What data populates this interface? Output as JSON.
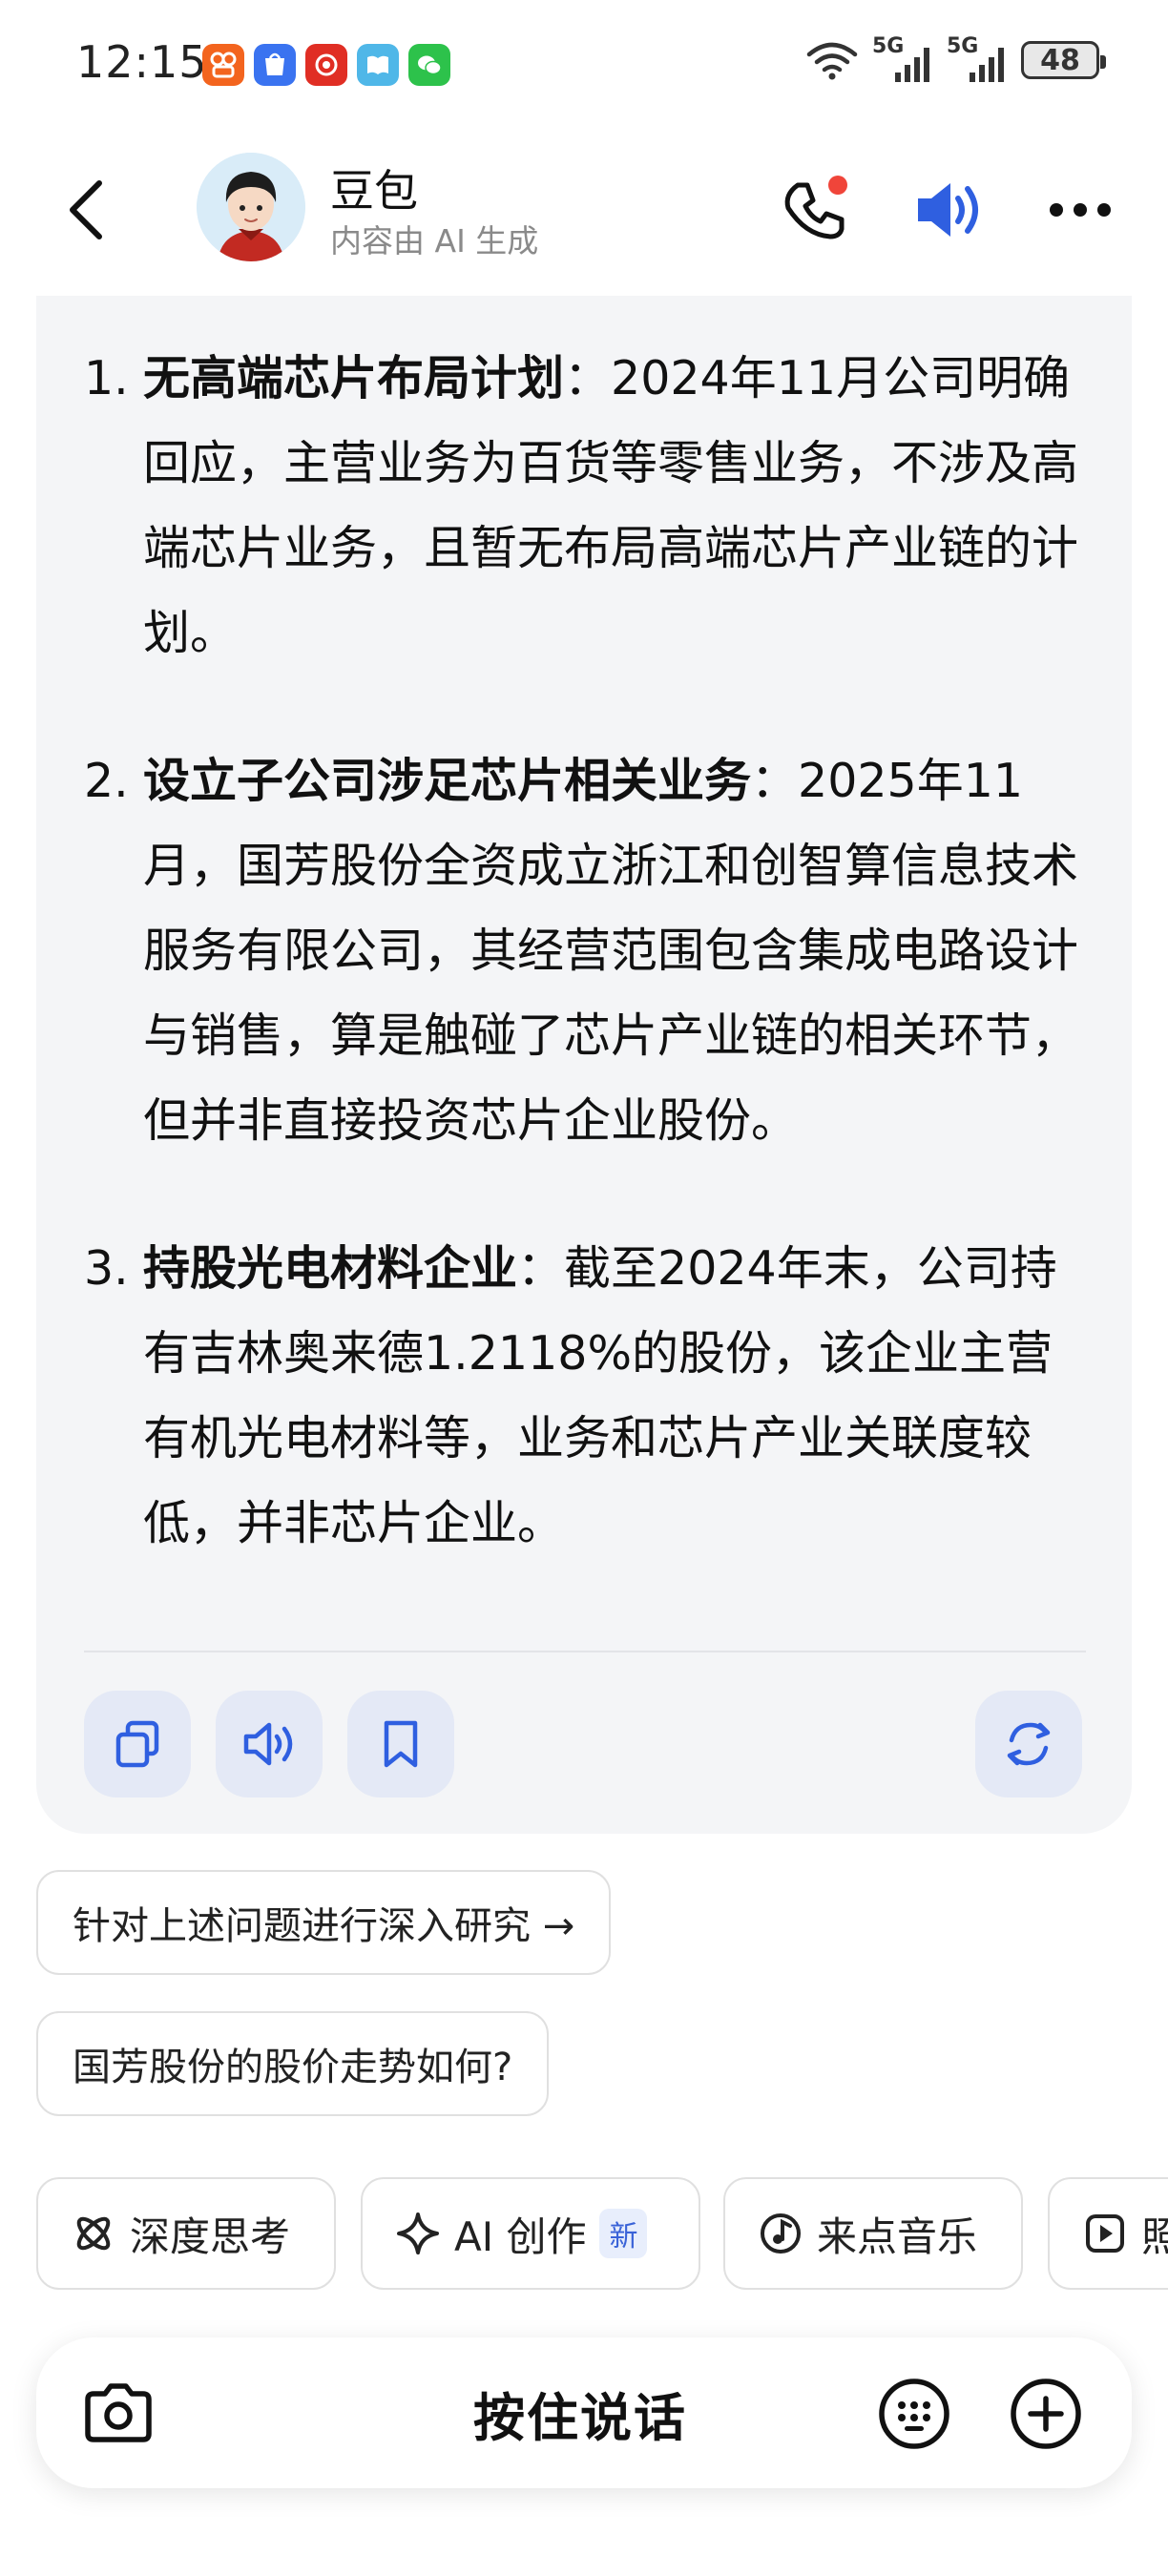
{
  "status_bar": {
    "time": "12:15",
    "app_icons": [
      "kuaishou-icon",
      "huawei-market-icon",
      "pinduoduo-icon",
      "reader-icon",
      "wechat-icon"
    ],
    "network_1": "5G",
    "network_2": "5G",
    "battery": "48"
  },
  "header": {
    "title": "豆包",
    "subtitle": "内容由 AI 生成"
  },
  "message": {
    "items": [
      {
        "num": "1.",
        "bold": "无高端芯片布局计划",
        "text": "：2024年11月公司明确回应，主营业务为百货等零售业务，不涉及高端芯片业务，且暂无布局高端芯片产业链的计划。"
      },
      {
        "num": "2.",
        "bold": "设立子公司涉足芯片相关业务",
        "text": "：2025年11月，国芳股份全资成立浙江和创智算信息技术服务有限公司，其经营范围包含集成电路设计与销售，算是触碰了芯片产业链的相关环节，但并非直接投资芯片企业股份。"
      },
      {
        "num": "3.",
        "bold": "持股光电材料企业",
        "text": "：截至2024年末，公司持有吉林奥来德1.2118%的股份，该企业主营有机光电材料等，业务和芯片产业关联度较低，并非芯片企业。"
      }
    ]
  },
  "suggestions": [
    "针对上述问题进行深入研究 →",
    "国芳股份的股价走势如何?"
  ],
  "chips": [
    {
      "label": "深度思考",
      "icon": "atom-icon"
    },
    {
      "label": "AI 创作",
      "icon": "sparkle-icon",
      "badge": "新"
    },
    {
      "label": "来点音乐",
      "icon": "music-icon"
    },
    {
      "label": "照",
      "icon": "video-icon"
    }
  ],
  "input_bar": {
    "hold_to_talk": "按住说话"
  },
  "colors": {
    "accent": "#2f5fe0",
    "card_bg": "#f4f5f7",
    "action_bg": "#e4e9f6",
    "call_dot": "#f0453a"
  }
}
